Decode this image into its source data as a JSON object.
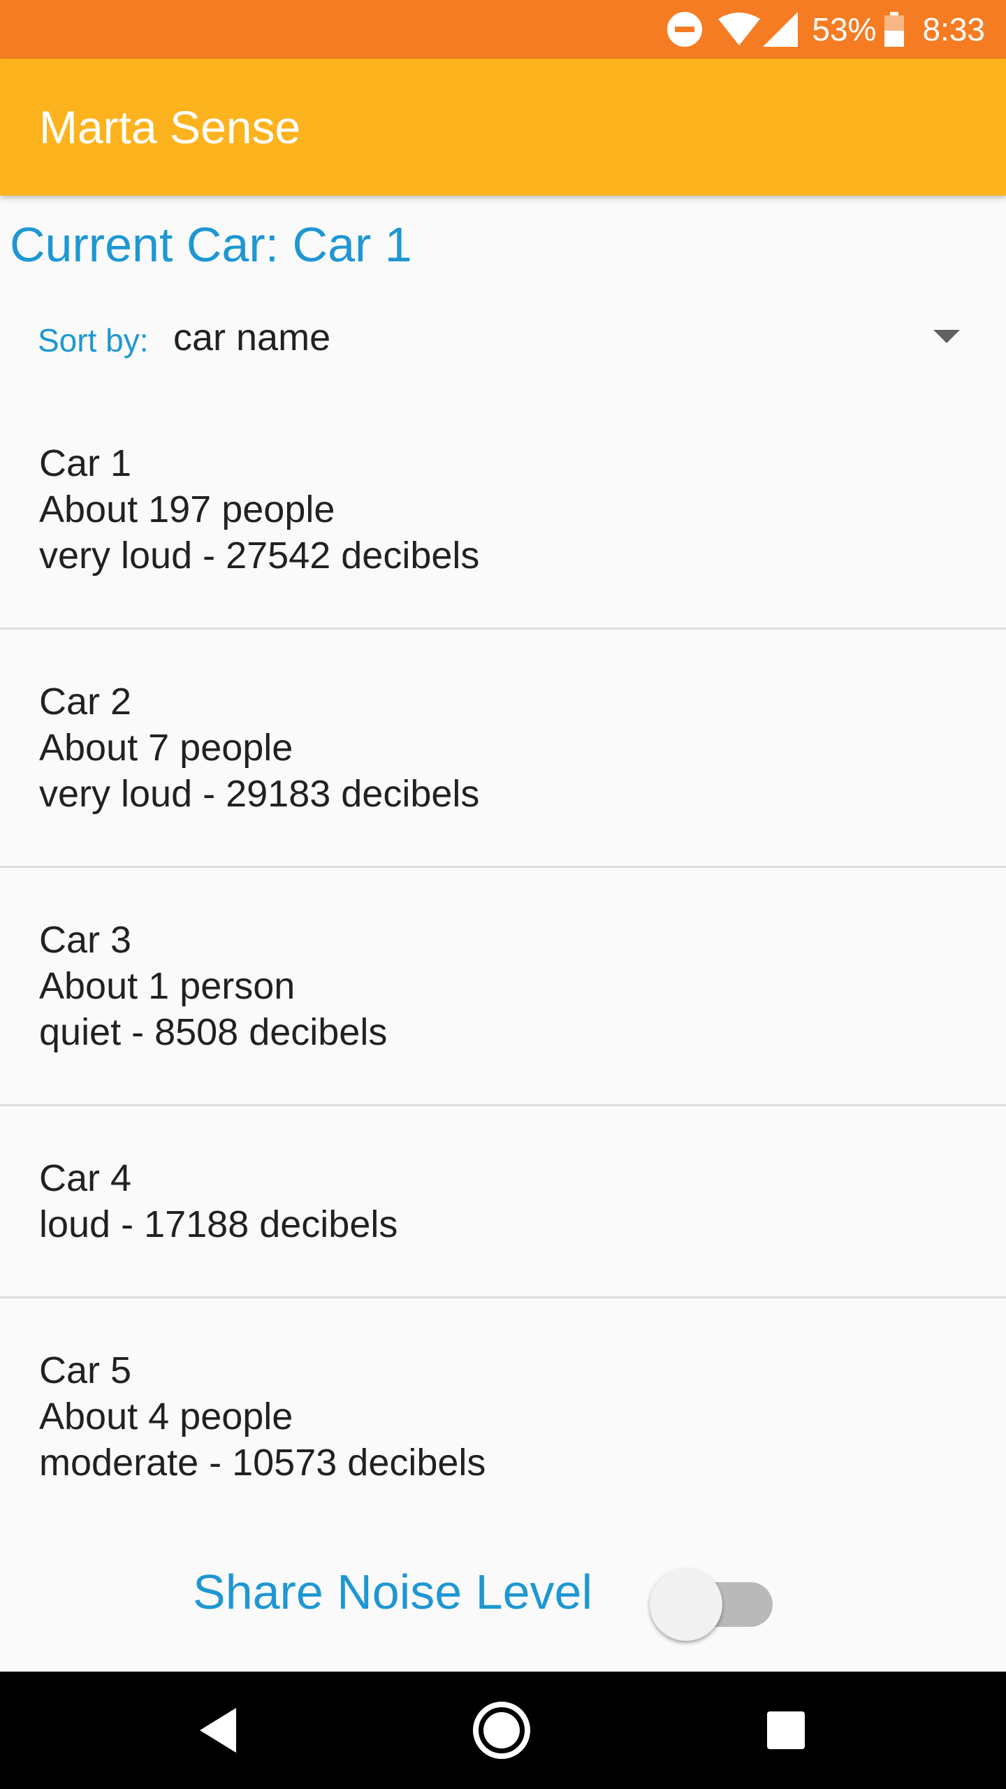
{
  "status_bar": {
    "battery_percent": "53%",
    "time": "8:33",
    "icons": [
      "do-not-disturb-icon",
      "wifi-icon",
      "cell-signal-icon",
      "battery-icon"
    ]
  },
  "app_bar": {
    "title": "Marta Sense"
  },
  "current_car": {
    "text": "Current Car: Car 1"
  },
  "sort": {
    "label": "Sort by:",
    "selected": "car name"
  },
  "cars": [
    {
      "name": "Car 1",
      "people": "About 197 people",
      "noise": "very loud - 27542 decibels"
    },
    {
      "name": "Car 2",
      "people": "About 7 people",
      "noise": "very loud - 29183 decibels"
    },
    {
      "name": "Car 3",
      "people": "About 1 person",
      "noise": "quiet - 8508 decibels"
    },
    {
      "name": "Car 4",
      "noise": "loud - 17188 decibels"
    },
    {
      "name": "Car 5",
      "people": "About 4 people",
      "noise": "moderate - 10573 decibels"
    }
  ],
  "share": {
    "label": "Share Noise Level",
    "enabled": false
  },
  "nav_bar": {
    "icons": [
      "back-icon",
      "home-icon",
      "recent-apps-icon"
    ]
  },
  "colors": {
    "status_bar": "#f57c22",
    "app_bar": "#fdb31e",
    "accent": "#1e97d3",
    "background": "#fafafa"
  }
}
